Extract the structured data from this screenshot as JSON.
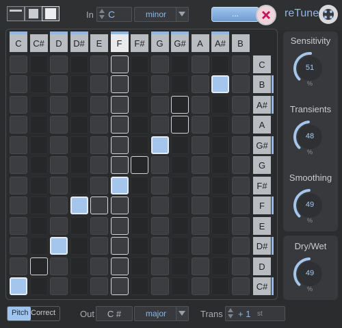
{
  "header": {
    "in_label": "In",
    "key_in": "C",
    "scale_in": "minor",
    "capture_button": "...",
    "brand": "reTune"
  },
  "columns": [
    "C",
    "C#",
    "D",
    "D#",
    "E",
    "F",
    "F#",
    "G",
    "G#",
    "A",
    "A#",
    "B"
  ],
  "rows": [
    "C",
    "B",
    "A#",
    "A",
    "G#",
    "G",
    "F#",
    "F",
    "E",
    "D#",
    "D",
    "C#"
  ],
  "knobs": [
    {
      "title": "Sensitivity",
      "value": "51",
      "unit": "%"
    },
    {
      "title": "Transients",
      "value": "48",
      "unit": "%"
    },
    {
      "title": "Smoothing",
      "value": "49",
      "unit": "%"
    },
    {
      "title": "Dry/Wet",
      "value": "49",
      "unit": "%"
    }
  ],
  "footer": {
    "pitch_label": "Pitch",
    "correct_label": "Correct",
    "out_label": "Out",
    "key_out": "C #",
    "scale_out": "major",
    "trans_label": "Trans",
    "trans_value": "+ 1",
    "trans_unit": "st"
  },
  "colors": {
    "accent": "#a5c6ec",
    "background": "#2b2c2e"
  }
}
